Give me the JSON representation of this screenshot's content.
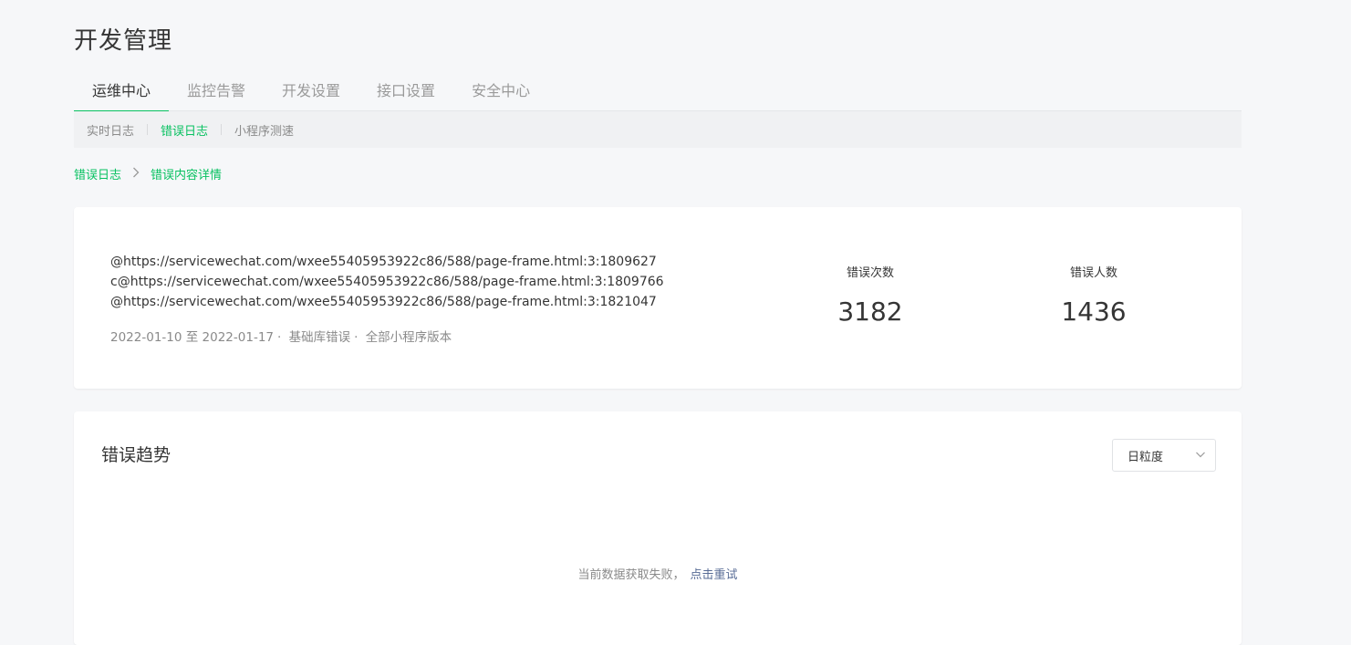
{
  "page": {
    "title": "开发管理"
  },
  "main_tabs": [
    {
      "label": "运维中心",
      "active": true
    },
    {
      "label": "监控告警",
      "active": false
    },
    {
      "label": "开发设置",
      "active": false
    },
    {
      "label": "接口设置",
      "active": false
    },
    {
      "label": "安全中心",
      "active": false
    }
  ],
  "sub_tabs": [
    {
      "label": "实时日志",
      "active": false
    },
    {
      "label": "错误日志",
      "active": true
    },
    {
      "label": "小程序测速",
      "active": false
    }
  ],
  "breadcrumb": {
    "parent": "错误日志",
    "separator": ">",
    "current": "错误内容详情"
  },
  "summary": {
    "stack_lines": [
      "@https://servicewechat.com/wxee55405953922c86/588/page-frame.html:3:1809627",
      "c@https://servicewechat.com/wxee55405953922c86/588/page-frame.html:3:1809766",
      "@https://servicewechat.com/wxee55405953922c86/588/page-frame.html:3:1821047"
    ],
    "date_range": "2022-01-10 至  2022-01-17",
    "error_type": "基础库错误",
    "version": "全部小程序版本",
    "stats": {
      "error_count_label": "错误次数",
      "error_count": "3182",
      "user_count_label": "错误人数",
      "user_count": "1436"
    }
  },
  "trend": {
    "title": "错误趋势",
    "granularity": "日粒度",
    "empty_message": "当前数据获取失败，",
    "retry_label": "点击重试"
  },
  "colors": {
    "accent": "#07c160",
    "link": "#576b95",
    "background": "#f6f7f9"
  },
  "icons": {
    "breadcrumb_separator": "chevron-right-icon",
    "select_arrow": "chevron-down-icon"
  }
}
